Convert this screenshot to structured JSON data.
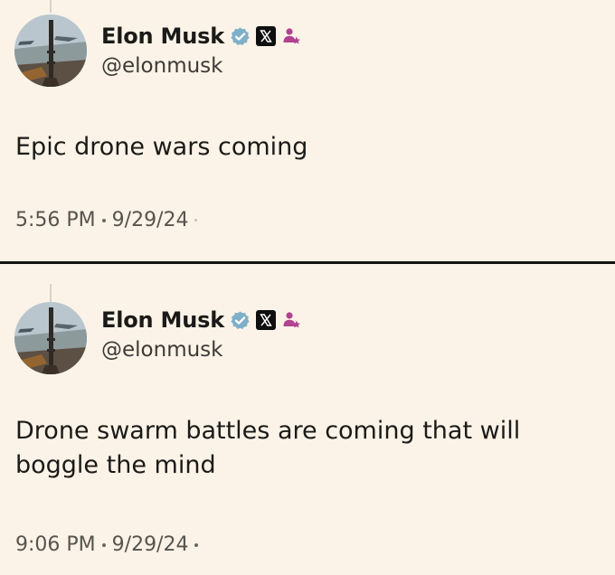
{
  "tweets": [
    {
      "author": {
        "name": "Elon Musk",
        "handle": "@elonmusk",
        "avatar_icon": "rocket-launch-avatar",
        "badges": [
          "verified-icon",
          "x-logo-icon",
          "affiliate-icon"
        ]
      },
      "text_lines": [
        "Epic drone wars coming"
      ],
      "time": "5:56 PM",
      "date": "9/29/24"
    },
    {
      "author": {
        "name": "Elon Musk",
        "handle": "@elonmusk",
        "avatar_icon": "rocket-launch-avatar",
        "badges": [
          "verified-icon",
          "x-logo-icon",
          "affiliate-icon"
        ]
      },
      "text_lines": [
        "Drone swarm battles are coming that will",
        "boggle the mind"
      ],
      "time": "9:06 PM",
      "date": "9/29/24"
    }
  ],
  "colors": {
    "background": "#fbf3e7",
    "text": "#1b1a18",
    "verified": "#7fb0c9",
    "affiliate": "#b0438f",
    "divider": "#161412"
  }
}
